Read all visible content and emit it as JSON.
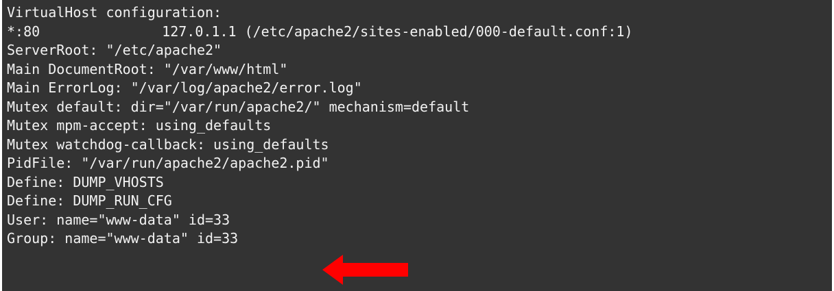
{
  "terminal": {
    "colors": {
      "background": "#333333",
      "text": "#f2f2f2",
      "arrow": "#ff0000"
    },
    "lines": [
      "VirtualHost configuration:",
      "*:80",
      "127.0.1.1 (/etc/apache2/sites-enabled/000-default.conf:1)",
      "ServerRoot: \"/etc/apache2\"",
      "Main DocumentRoot: \"/var/www/html\"",
      "Main ErrorLog: \"/var/log/apache2/error.log\"",
      "Mutex default: dir=\"/var/run/apache2/\" mechanism=default",
      "Mutex mpm-accept: using_defaults",
      "Mutex watchdog-callback: using_defaults",
      "PidFile: \"/var/run/apache2/apache2.pid\"",
      "Define: DUMP_VHOSTS",
      "Define: DUMP_RUN_CFG",
      "User: name=\"www-data\" id=33",
      "Group: name=\"www-data\" id=33"
    ],
    "annotation_icon": "left-arrow-icon"
  }
}
